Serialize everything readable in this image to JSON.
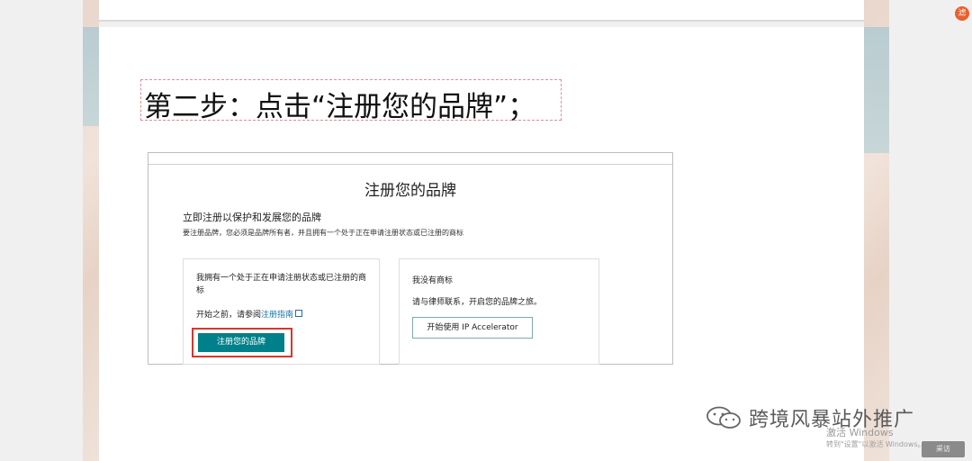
{
  "slide": {
    "heading": "第二步：点击“注册您的品牌”；"
  },
  "screenshot": {
    "title": "注册您的品牌",
    "subtitle": "立即注册以保护和发展您的品牌",
    "description": "要注册品牌，您必须是品牌所有者，并且拥有一个处于正在申请注册状态或已注册的商标",
    "left_card": {
      "text": "我拥有一个处于正在申请注册状态或已注册的商标",
      "note_prefix": "开始之前，请参阅",
      "note_link": "注册指南",
      "button_label": "注册您的品牌"
    },
    "right_card": {
      "title": "我没有商标",
      "description": "请与律师联系，开启您的品牌之旅。",
      "button_label": "开始使用 IP Accelerator"
    }
  },
  "watermark": {
    "text": "跨境风暴站外推广"
  },
  "windows": {
    "activate_title": "激活 Windows",
    "activate_hint": "转到\"设置\"以激活 Windows。"
  },
  "toolbar": {
    "next_label": "采访"
  },
  "corner": {
    "badge": "滤"
  },
  "colors": {
    "primary_button": "#00808a",
    "highlight_border": "#d9352c",
    "heading_box_border": "#e38b95"
  }
}
